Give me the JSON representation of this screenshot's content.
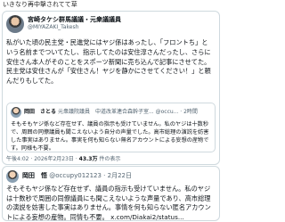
{
  "caption": "いきなり再中撃されてて草",
  "post1": {
    "author_name": "宮崎タケシ群馬議議・元衆議議員",
    "author_handle": "@MIYAZAKI_Takesh",
    "body": "私がいた頃の民主党・民進党にはヤジ係はあったし、「フロントち」という名前までついてたし、指示してたのは安住淳さんだったし、さらに安住さん本人がそのことをスポーツ新聞に売ち込んで記事にさせてた。 民主党は安住さんが「安住さん！ヤジを静かにさせてください！」と頼んだりもしてた。",
    "quote": {
      "author_name": "岡田　さとる",
      "tag": "元衆議院議員　中道改革連合森幹子室...",
      "meta": "@occu... · 2時間",
      "body": "そもそもヤジ係など存在せず、議員の指示も受けていません。私のヤジは十数秒で、周囲の同僚議員も聞こえないよう自分の声量でした。高市総理の演説を妨害した事実はありません。事実を何も知らない無名アカウントによる妄想の産物です。同様も不要。"
    },
    "timestamp": "午後4:02 · 2026年2月23日",
    "views": "43.3万",
    "views_label": "件の表示"
  },
  "post2": {
    "author_name": "岡田　悟",
    "author_handle": "@occupy012123 · 2月22日",
    "body": "そもそもヤジ係など存在せず、議員の指示も受けていません。私のヤジは十数秒で周囲の同僚議員にも聞こえないような声量であり、高市総理の演説を妨害した事実はありません。事情を何も知らない匿名アカウントによる妄想の産物。同情も不要。 x.com/Diakai2/status..."
  }
}
